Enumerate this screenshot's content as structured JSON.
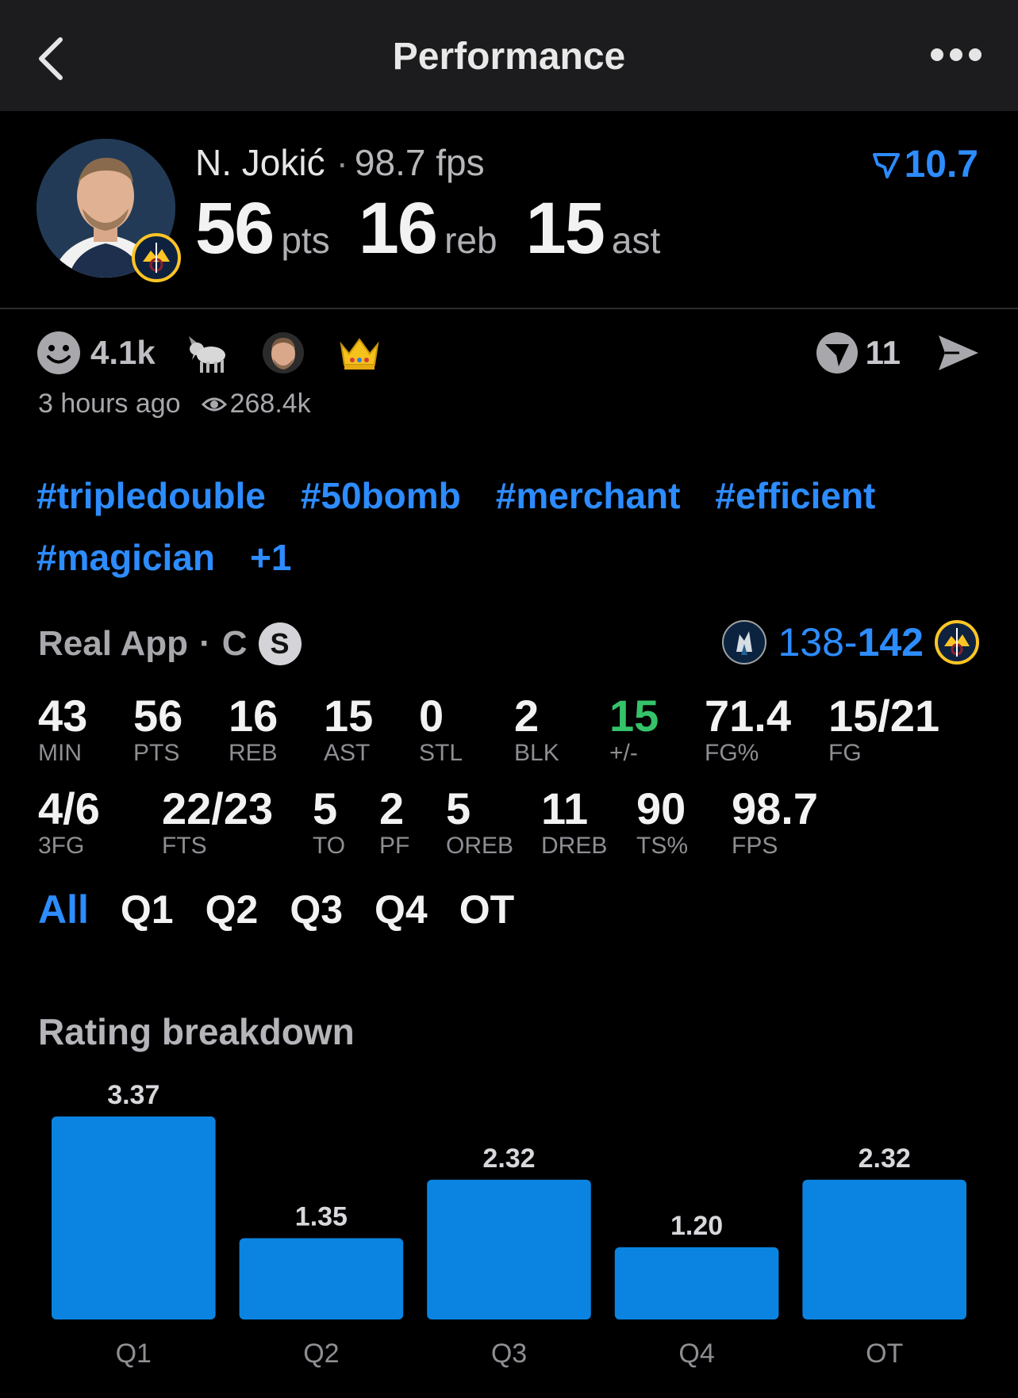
{
  "header": {
    "title": "Performance"
  },
  "player": {
    "name": "N. Jokić",
    "separator": "·",
    "fps_text": "98.7 fps",
    "rank_value": "10.7"
  },
  "headline": [
    {
      "value": "56",
      "unit": "pts"
    },
    {
      "value": "16",
      "unit": "reb"
    },
    {
      "value": "15",
      "unit": "ast"
    }
  ],
  "reactions": {
    "count": "4.1k",
    "emojis": [
      "goat-emoji",
      "player-face-emoji",
      "crown-emoji"
    ],
    "vote_count": "11"
  },
  "meta": {
    "time": "3 hours ago",
    "views": "268.4k"
  },
  "tags": [
    "#tripledouble",
    "#50bomb",
    "#merchant",
    "#efficient",
    "#magician",
    "+1"
  ],
  "game": {
    "source": "Real App",
    "separator": "·",
    "position": "C",
    "badge": "S",
    "score_left": "138",
    "score_dash": "-",
    "score_right": "142"
  },
  "stats_row1": [
    {
      "value": "43",
      "label": "MIN"
    },
    {
      "value": "56",
      "label": "PTS"
    },
    {
      "value": "16",
      "label": "REB"
    },
    {
      "value": "15",
      "label": "AST"
    },
    {
      "value": "0",
      "label": "STL"
    },
    {
      "value": "2",
      "label": "BLK"
    },
    {
      "value": "15",
      "label": "+/-"
    },
    {
      "value": "71.4",
      "label": "FG%"
    },
    {
      "value": "15/21",
      "label": "FG"
    }
  ],
  "stats_row2": [
    {
      "value": "4/6",
      "label": "3FG"
    },
    {
      "value": "22/23",
      "label": "FTS"
    },
    {
      "value": "5",
      "label": "TO"
    },
    {
      "value": "2",
      "label": "PF"
    },
    {
      "value": "5",
      "label": "OREB"
    },
    {
      "value": "11",
      "label": "DREB"
    },
    {
      "value": "90",
      "label": "TS%"
    },
    {
      "value": "98.7",
      "label": "FPS"
    }
  ],
  "period_tabs": {
    "active": "All",
    "items": [
      "All",
      "Q1",
      "Q2",
      "Q3",
      "Q4",
      "OT"
    ]
  },
  "rating": {
    "title": "Rating breakdown"
  },
  "colors": {
    "accent": "#2d8cff",
    "bar": "#0a84e0",
    "positive": "#35c36a",
    "header_bg": "#1c1c1e"
  },
  "chart_data": {
    "type": "bar",
    "title": "Rating breakdown",
    "categories": [
      "Q1",
      "Q2",
      "Q3",
      "Q4",
      "OT"
    ],
    "values": [
      3.37,
      1.35,
      2.32,
      1.2,
      2.32
    ],
    "value_labels": [
      "3.37",
      "1.35",
      "2.32",
      "1.20",
      "2.32"
    ],
    "ylim": [
      0,
      3.37
    ],
    "grid": false,
    "legend": "none"
  }
}
